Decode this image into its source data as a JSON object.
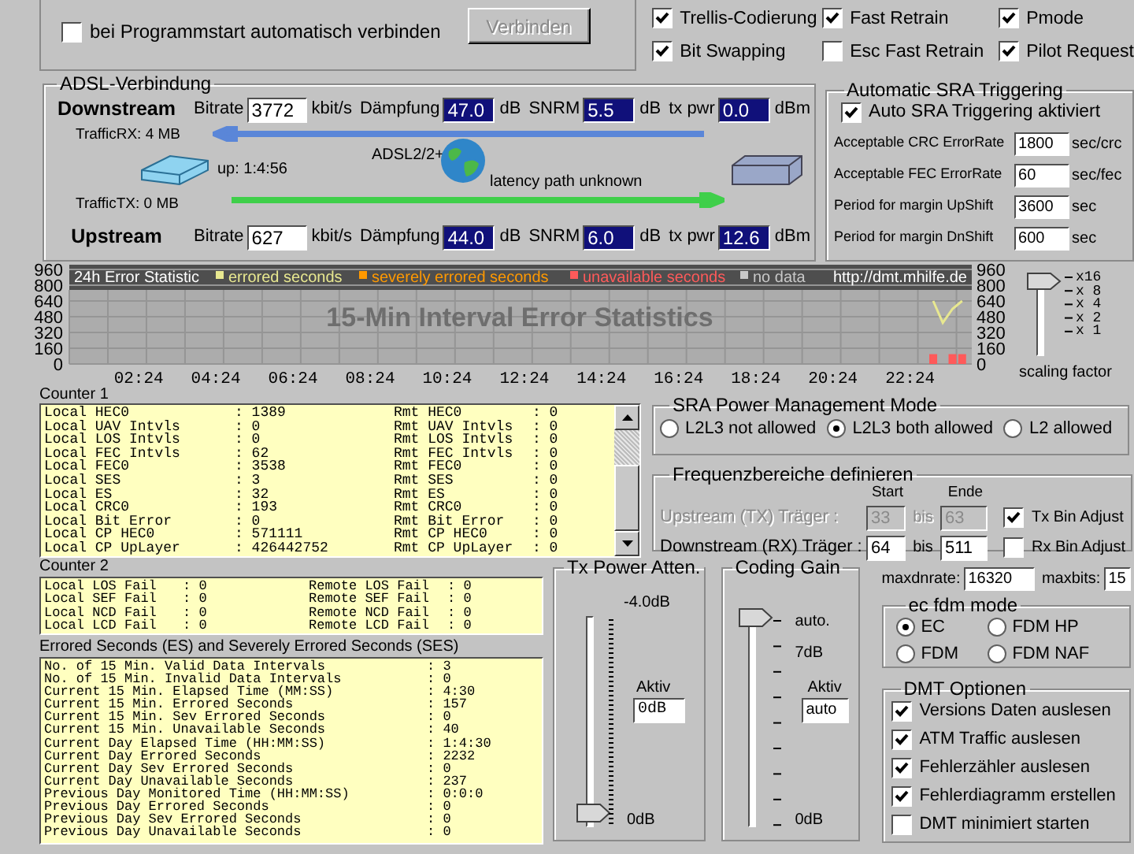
{
  "top": {
    "autoconnect": {
      "label": "bei Programmstart automatisch verbinden",
      "checked": false
    },
    "connect_button": {
      "label": "Verbinden",
      "disabled": true
    }
  },
  "options": [
    {
      "label": "Trellis-Codierung",
      "checked": true
    },
    {
      "label": "Fast Retrain",
      "checked": true
    },
    {
      "label": "Pmode",
      "checked": true
    },
    {
      "label": "Bit Swapping",
      "checked": true
    },
    {
      "label": "Esc Fast Retrain",
      "checked": false
    },
    {
      "label": "Pilot Request",
      "checked": true
    }
  ],
  "adsl": {
    "title": "ADSL-Verbindung",
    "streams": [
      {
        "name": "Downstream",
        "fields": [
          {
            "label": "Bitrate",
            "value": "3772",
            "unit": "kbit/s",
            "kind": "input"
          },
          {
            "label": "Dämpfung",
            "value": "47.0",
            "unit": "dB",
            "kind": "readout"
          },
          {
            "label": "SNRM",
            "value": "5.5",
            "unit": "dB",
            "kind": "readout"
          },
          {
            "label": "tx pwr",
            "value": "0.0",
            "unit": "dBm",
            "kind": "readout"
          }
        ]
      },
      {
        "name": "Upstream",
        "fields": [
          {
            "label": "Bitrate",
            "value": "627",
            "unit": "kbit/s",
            "kind": "input"
          },
          {
            "label": "Dämpfung",
            "value": "44.0",
            "unit": "dB",
            "kind": "readout"
          },
          {
            "label": "SNRM",
            "value": "6.0",
            "unit": "dB",
            "kind": "readout"
          },
          {
            "label": "tx pwr",
            "value": "12.6",
            "unit": "dBm",
            "kind": "readout"
          }
        ]
      }
    ],
    "traffic_rx": "TrafficRX: 4 MB",
    "traffic_tx": "TrafficTX: 0 MB",
    "uptime": "up: 1:4:56",
    "mode": "ADSL2/2+",
    "latency": "latency path unknown"
  },
  "sra_trigger": {
    "title": "Automatic SRA Triggering",
    "enabled": {
      "label": "Auto SRA Triggering aktiviert",
      "checked": true
    },
    "rows": [
      {
        "label": "Acceptable CRC ErrorRate",
        "value": "1800",
        "unit": "sec/crc"
      },
      {
        "label": "Acceptable FEC ErrorRate",
        "value": "60",
        "unit": "sec/fec"
      },
      {
        "label": "Period for margin UpShift",
        "value": "3600",
        "unit": "sec"
      },
      {
        "label": "Period for margin DnShift",
        "value": "600",
        "unit": "sec"
      }
    ]
  },
  "error_chart": {
    "header": "24h Error Statistic",
    "url": "http://dmt.mhilfe.de",
    "watermark": "15-Min Interval Error Statistics",
    "right_ticks": [
      "960",
      "800",
      "640",
      "480",
      "320",
      "160",
      "0"
    ],
    "chart_data": {
      "type": "line",
      "x": [
        23.0,
        23.25,
        23.5,
        23.75
      ],
      "series": [
        {
          "name": "errored seconds",
          "color": "#e8e890",
          "type": "line",
          "values": [
            640,
            420,
            560,
            640
          ]
        },
        {
          "name": "severely errored seconds",
          "color": "#ff9900",
          "type": "bar",
          "values": [
            null,
            null,
            null,
            null
          ]
        },
        {
          "name": "unavailable seconds",
          "color": "#ff5a5a",
          "type": "bar",
          "values": [
            100,
            0,
            100,
            100
          ]
        },
        {
          "name": "no data",
          "color": "#c8c8c8",
          "type": "bar",
          "values": [
            null,
            null,
            null,
            null
          ]
        }
      ],
      "grid": true,
      "legend": "top",
      "xlim": [
        0.6,
        24.0
      ],
      "ylim": [
        0,
        960
      ],
      "xticks": [
        {
          "value": 2.4,
          "label": "02:24"
        },
        {
          "value": 4.4,
          "label": "04:24"
        },
        {
          "value": 6.4,
          "label": "06:24"
        },
        {
          "value": 8.4,
          "label": "08:24"
        },
        {
          "value": 10.4,
          "label": "10:24"
        },
        {
          "value": 12.4,
          "label": "12:24"
        },
        {
          "value": 14.4,
          "label": "14:24"
        },
        {
          "value": 16.4,
          "label": "16:24"
        },
        {
          "value": 18.4,
          "label": "18:24"
        },
        {
          "value": 20.4,
          "label": "20:24"
        },
        {
          "value": 22.4,
          "label": "22:24"
        }
      ],
      "yticks": [
        {
          "value": 0,
          "label": "0"
        },
        {
          "value": 160,
          "label": "160"
        },
        {
          "value": 320,
          "label": "320"
        },
        {
          "value": 480,
          "label": "480"
        },
        {
          "value": 640,
          "label": "640"
        },
        {
          "value": 800,
          "label": "800"
        },
        {
          "value": 960,
          "label": "960"
        }
      ]
    }
  },
  "scaling": {
    "labels": [
      "x16",
      "x 8",
      "x 4",
      "x 2",
      "x 1"
    ],
    "caption": "scaling factor",
    "level": 1
  },
  "counter1": {
    "title": "Counter 1",
    "rows": [
      [
        "Local HEC0",
        ": 1389",
        "Rmt HEC0",
        ": 0"
      ],
      [
        "Local UAV Intvls",
        ": 0",
        "Rmt UAV Intvls",
        ": 0"
      ],
      [
        "Local LOS Intvls",
        ": 0",
        "Rmt LOS Intvls",
        ": 0"
      ],
      [
        "Local FEC Intvls",
        ": 62",
        "Rmt FEC Intvls",
        ": 0"
      ],
      [
        "Local FEC0",
        ": 3538",
        "Rmt FEC0",
        ": 0"
      ],
      [
        "Local SES",
        ": 3",
        "Rmt SES",
        ": 0"
      ],
      [
        "Local ES",
        ": 32",
        "Rmt ES",
        ": 0"
      ],
      [
        "Local CRC0",
        ": 193",
        "Rmt CRC0",
        ": 0"
      ],
      [
        "Local Bit Error",
        ": 0",
        "Rmt Bit Error",
        ": 0"
      ],
      [
        "Local CP HEC0",
        ": 571111",
        "Rmt CP HEC0",
        ": 0"
      ],
      [
        "Local CP UpLayer",
        ": 426442752",
        "Rmt CP UpLayer",
        ": 0"
      ]
    ]
  },
  "counter2": {
    "title": "Counter 2",
    "rows": [
      [
        "Local LOS Fail",
        ": 0",
        "Remote LOS Fail",
        ": 0"
      ],
      [
        "Local SEF Fail",
        ": 0",
        "Remote SEF Fail",
        ": 0"
      ],
      [
        "Local NCD Fail",
        ": 0",
        "Remote NCD Fail",
        ": 0"
      ],
      [
        "Local LCD Fail",
        ": 0",
        "Remote LCD Fail",
        ": 0"
      ]
    ]
  },
  "errored_seconds": {
    "title": "Errored Seconds (ES) and Severely Errored Seconds (SES)",
    "rows": [
      [
        "No. of 15 Min. Valid Data Intervals",
        ": 3"
      ],
      [
        "No. of 15 Min. Invalid Data Intervals",
        ": 0"
      ],
      [
        "Current 15 Min. Elapsed Time (MM:SS)",
        ": 4:30"
      ],
      [
        "Current 15 Min. Errored Seconds",
        ": 157"
      ],
      [
        "Current 15 Min. Sev Errored Seconds",
        ": 0"
      ],
      [
        "Current 15 Min. Unavailable Seconds",
        ": 40"
      ],
      [
        "Current Day Elapsed Time (HH:MM:SS)",
        ": 1:4:30"
      ],
      [
        "Current Day Errored Seconds",
        ": 2232"
      ],
      [
        "Current Day Sev Errored Seconds",
        ": 0"
      ],
      [
        "Current Day Unavailable Seconds",
        ": 237"
      ],
      [
        "Previous Day Monitored Time (HH:MM:SS)",
        ": 0:0:0"
      ],
      [
        "Previous Day Errored Seconds",
        ": 0"
      ],
      [
        "Previous Day Sev Errored Seconds",
        ": 0"
      ],
      [
        "Previous Day Unavailable Seconds",
        ": 0"
      ]
    ]
  },
  "power_mode": {
    "title": "SRA Power Management Mode",
    "options": [
      {
        "label": "L2L3 not allowed",
        "selected": false
      },
      {
        "label": "L2L3 both allowed",
        "selected": true
      },
      {
        "label": "L2 allowed",
        "selected": false
      }
    ]
  },
  "frequency": {
    "title": "Frequenzbereiche definieren",
    "start_label": "Start",
    "end_label": "Ende",
    "rows": [
      {
        "label": "Upstream (TX) Träger :",
        "start": "33",
        "between": "bis",
        "end": "63",
        "disabled": true,
        "adjust": {
          "label": "Tx Bin Adjust",
          "checked": true
        }
      },
      {
        "label": "Downstream (RX) Träger :",
        "start": "64",
        "between": "bis",
        "end": "511",
        "disabled": false,
        "adjust": {
          "label": "Rx Bin Adjust",
          "checked": false
        }
      }
    ]
  },
  "tx_power": {
    "title": "Tx Power Atten.",
    "top_label": "-4.0dB",
    "bottom_label": "0dB",
    "level": 0,
    "active_label": "Aktiv",
    "active_value": "0dB"
  },
  "coding_gain": {
    "title": "Coding Gain",
    "labels": [
      "auto.",
      "7dB",
      "0dB"
    ],
    "level": 1,
    "active_label": "Aktiv",
    "active_value": "auto"
  },
  "limits": [
    {
      "label": "maxdnrate:",
      "value": "16320"
    },
    {
      "label": "maxbits:",
      "value": "15"
    }
  ],
  "ec_fdm": {
    "title": "ec fdm mode",
    "options": [
      {
        "label": "EC",
        "selected": true
      },
      {
        "label": "FDM HP",
        "selected": false
      },
      {
        "label": "FDM",
        "selected": false
      },
      {
        "label": "FDM NAF",
        "selected": false
      }
    ]
  },
  "dmt": {
    "title": "DMT Optionen",
    "options": [
      {
        "label": "Versions Daten auslesen",
        "checked": true
      },
      {
        "label": "ATM Traffic auslesen",
        "checked": true
      },
      {
        "label": "Fehlerzähler auslesen",
        "checked": true
      },
      {
        "label": "Fehlerdiagramm erstellen",
        "checked": true
      },
      {
        "label": "DMT minimiert starten",
        "checked": false
      }
    ]
  }
}
